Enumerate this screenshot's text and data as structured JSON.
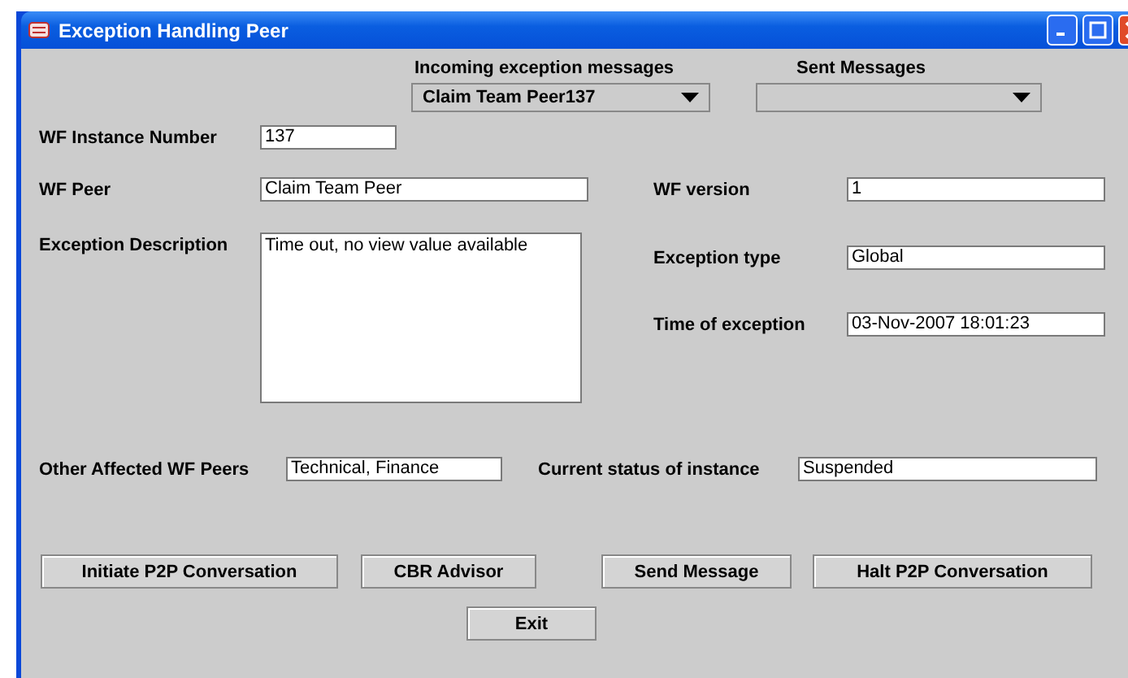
{
  "window": {
    "title": "Exception Handling Peer"
  },
  "incoming": {
    "label": "Incoming exception messages",
    "value": "Claim Team Peer137"
  },
  "sent": {
    "label": "Sent Messages"
  },
  "instance": {
    "label": "WF Instance Number",
    "value": "137"
  },
  "peer": {
    "label": "WF Peer",
    "value": "Claim Team Peer"
  },
  "version": {
    "label": "WF version",
    "value": "1"
  },
  "description": {
    "label": "Exception Description",
    "value": "Time out, no view value available"
  },
  "type": {
    "label": "Exception type",
    "value": "Global"
  },
  "time": {
    "label": "Time of exception",
    "value": "03-Nov-2007 18:01:23"
  },
  "affected": {
    "label": "Other Affected WF Peers",
    "value": "Technical, Finance"
  },
  "status": {
    "label": "Current status of instance",
    "value": "Suspended"
  },
  "buttons": [
    "Initiate P2P Conversation",
    "CBR Advisor",
    "Send Message",
    "Halt P2P Conversation"
  ],
  "exit": "Exit"
}
